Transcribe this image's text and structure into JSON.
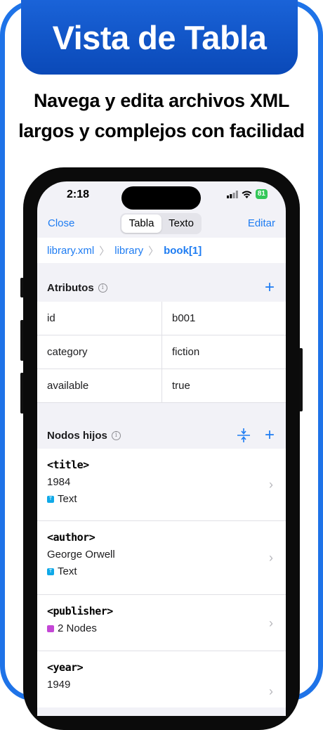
{
  "banner": {
    "title": "Vista de Tabla"
  },
  "subtitle": {
    "line1": "Navega y edita archivos XML",
    "line2": "largos y complejos con facilidad"
  },
  "status": {
    "time": "2:18",
    "battery": "81"
  },
  "navbar": {
    "close_label": "Close",
    "tabs": [
      {
        "label": "Tabla",
        "active": true
      },
      {
        "label": "Texto",
        "active": false
      }
    ],
    "edit_label": "Editar"
  },
  "breadcrumb": {
    "items": [
      "library.xml",
      "library",
      "book[1]"
    ]
  },
  "attributes": {
    "title": "Atributos",
    "rows": [
      {
        "name": "id",
        "value": "b001"
      },
      {
        "name": "category",
        "value": "fiction"
      },
      {
        "name": "available",
        "value": "true"
      }
    ]
  },
  "children": {
    "title": "Nodos hijos",
    "items": [
      {
        "tag": "<title>",
        "value": "1984",
        "type": "Text",
        "type_color": "#10a9e8"
      },
      {
        "tag": "<author>",
        "value": "George Orwell",
        "type": "Text",
        "type_color": "#10a9e8"
      },
      {
        "tag": "<publisher>",
        "value": "",
        "type": "2 Nodes",
        "type_color": "#c447d6"
      },
      {
        "tag": "<year>",
        "value": "1949",
        "type": "",
        "type_color": ""
      }
    ]
  },
  "colors": {
    "accent": "#1e7cf2",
    "banner": "#0a49b8",
    "frame": "#1e73e8"
  }
}
